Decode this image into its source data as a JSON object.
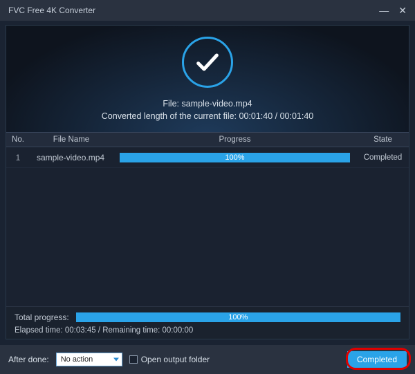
{
  "titlebar": {
    "title": "FVC Free 4K Converter"
  },
  "hero": {
    "file_label": "File: sample-video.mp4",
    "converted_label": "Converted length of the current file: 00:01:40 / 00:01:40"
  },
  "table": {
    "headers": {
      "no": "No.",
      "file_name": "File Name",
      "progress": "Progress",
      "state": "State"
    },
    "rows": [
      {
        "no": "1",
        "file_name": "sample-video.mp4",
        "progress_pct": 100,
        "progress_label": "100%",
        "state": "Completed"
      }
    ]
  },
  "summary": {
    "total_label": "Total progress:",
    "total_pct": 100,
    "total_pct_label": "100%",
    "time_label": "Elapsed time: 00:03:45 / Remaining time: 00:00:00"
  },
  "footer": {
    "after_done_label": "After done:",
    "after_done_selected": "No action",
    "open_output_label": "Open output folder",
    "open_output_checked": false,
    "completed_button": "Completed"
  }
}
